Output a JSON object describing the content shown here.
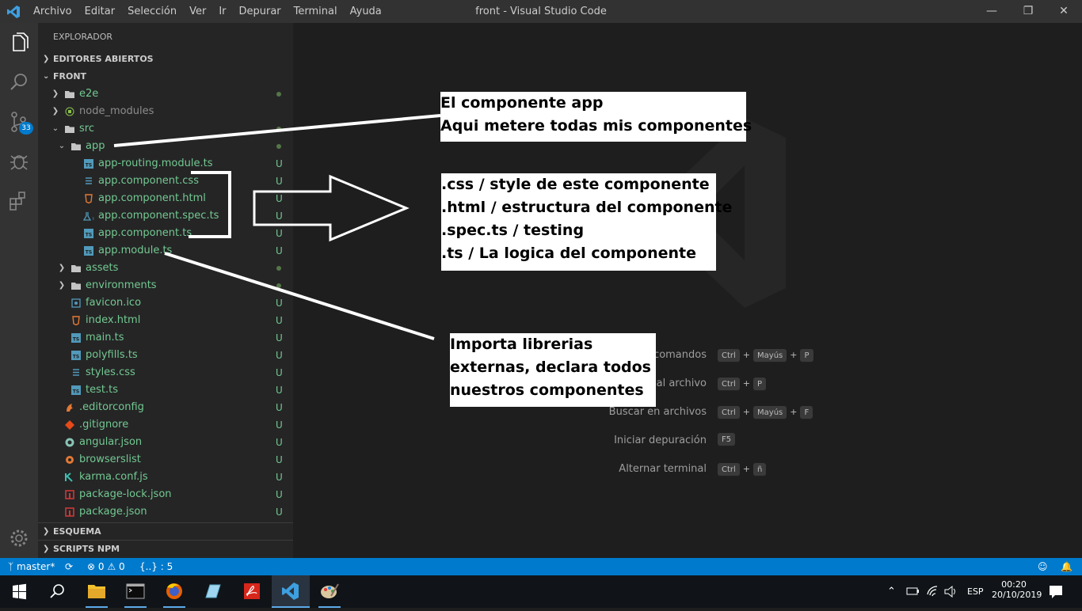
{
  "window": {
    "title": "front - Visual Studio Code",
    "menu": [
      "Archivo",
      "Editar",
      "Selección",
      "Ver",
      "Ir",
      "Depurar",
      "Terminal",
      "Ayuda"
    ]
  },
  "activity_bar": {
    "items": [
      "files-icon",
      "search-icon",
      "source-control-icon",
      "debug-icon",
      "extensions-icon"
    ],
    "scm_badge": "33",
    "bottom": "manage-gear-icon"
  },
  "sidebar": {
    "title": "EXPLORADOR",
    "open_editors": "EDITORES ABIERTOS",
    "project": "FRONT",
    "outline": "ESQUEMA",
    "npm": "SCRIPTS NPM",
    "tree": [
      {
        "name": "e2e",
        "status": "dot"
      },
      {
        "name": "node_modules",
        "status": ""
      },
      {
        "name": "src",
        "status": "dot"
      },
      {
        "name": "app",
        "status": "dot"
      },
      {
        "name": "app-routing.module.ts",
        "status": "U"
      },
      {
        "name": "app.component.css",
        "status": "U"
      },
      {
        "name": "app.component.html",
        "status": "U"
      },
      {
        "name": "app.component.spec.ts",
        "status": "U"
      },
      {
        "name": "app.component.ts",
        "status": "U"
      },
      {
        "name": "app.module.ts",
        "status": "U"
      },
      {
        "name": "assets",
        "status": "dot"
      },
      {
        "name": "environments",
        "status": "dot"
      },
      {
        "name": "favicon.ico",
        "status": "U"
      },
      {
        "name": "index.html",
        "status": "U"
      },
      {
        "name": "main.ts",
        "status": "U"
      },
      {
        "name": "polyfills.ts",
        "status": "U"
      },
      {
        "name": "styles.css",
        "status": "U"
      },
      {
        "name": "test.ts",
        "status": "U"
      },
      {
        "name": ".editorconfig",
        "status": "U"
      },
      {
        "name": ".gitignore",
        "status": "U"
      },
      {
        "name": "angular.json",
        "status": "U"
      },
      {
        "name": "browserslist",
        "status": "U"
      },
      {
        "name": "karma.conf.js",
        "status": "U"
      },
      {
        "name": "package-lock.json",
        "status": "U"
      },
      {
        "name": "package.json",
        "status": "U"
      }
    ]
  },
  "editor": {
    "shortcuts": [
      {
        "label": "comandos",
        "keys": [
          "Ctrl",
          "Mayús",
          "P"
        ]
      },
      {
        "label": "al archivo",
        "keys": [
          "Ctrl",
          "P"
        ]
      },
      {
        "label": "Buscar en archivos",
        "keys": [
          "Ctrl",
          "Mayús",
          "F"
        ]
      },
      {
        "label": "Iniciar depuración",
        "keys": [
          "F5"
        ]
      },
      {
        "label": "Alternar terminal",
        "keys": [
          "Ctrl",
          "ñ"
        ]
      }
    ]
  },
  "annotations": {
    "app_note": [
      "El componente app",
      "Aqui metere todas mis componentes"
    ],
    "files_note": [
      ".css / style de este componente",
      ".html / estructura del componente",
      ".spec.ts / testing",
      ".ts / La logica del componente"
    ],
    "module_note": [
      "Importa librerias",
      "externas, declara todos",
      "nuestros componentes"
    ]
  },
  "statusbar": {
    "branch": "master*",
    "errors": "0",
    "warnings": "0",
    "braces": "{..} : 5"
  },
  "taskbar": {
    "lang": "ESP",
    "time": "00:20",
    "date": "20/10/2019"
  },
  "colors": {
    "accent": "#007acc",
    "untracked": "#73c991",
    "annotation_bg": "#ffffff"
  }
}
